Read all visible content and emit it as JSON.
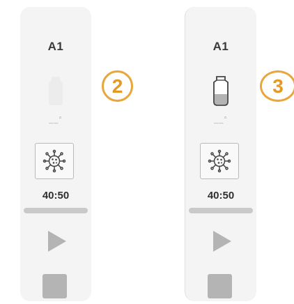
{
  "panels": [
    {
      "slot_label": "A1",
      "temperature": "__°",
      "time": "40:50",
      "progress": 0,
      "tube_state": "empty-faded",
      "icons": {
        "tube": "tube-icon",
        "virus": "virus-icon",
        "play": "play-icon",
        "stop": "stop-icon"
      }
    },
    {
      "slot_label": "A1",
      "temperature": "__°",
      "time": "40:50",
      "progress": 0,
      "tube_state": "loaded",
      "icons": {
        "tube": "tube-icon",
        "virus": "virus-icon",
        "play": "play-icon",
        "stop": "stop-icon"
      }
    }
  ],
  "badges": [
    "2",
    "3"
  ],
  "colors": {
    "accent": "#e8a63b",
    "panel_bg": "#f4f4f4",
    "control_gray": "#b4b4b4"
  }
}
